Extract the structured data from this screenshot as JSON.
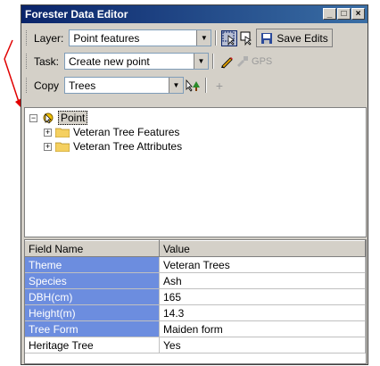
{
  "window": {
    "title": "Forester Data Editor",
    "controls": [
      "minimize",
      "maximize",
      "close"
    ]
  },
  "toolbar1": {
    "layer_label": "Layer:",
    "layer_value": "Point features",
    "save_label": "Save Edits"
  },
  "toolbar2": {
    "task_label": "Task:",
    "task_value": "Create new point",
    "gps_label": "GPS"
  },
  "toolbar3": {
    "copy_label": "Copy",
    "copy_value": "Trees"
  },
  "tree": {
    "root": "Point",
    "children": [
      "Veteran Tree Features",
      "Veteran Tree Attributes"
    ]
  },
  "grid": {
    "headers": [
      "Field Name",
      "Value"
    ],
    "rows": [
      {
        "field": "Theme",
        "value": "Veteran Trees",
        "highlight": true
      },
      {
        "field": "Species",
        "value": "Ash",
        "highlight": true
      },
      {
        "field": "DBH(cm)",
        "value": "165",
        "highlight": true
      },
      {
        "field": "Height(m)",
        "value": "14.3",
        "highlight": true
      },
      {
        "field": "Tree Form",
        "value": "Maiden form",
        "highlight": true
      },
      {
        "field": "Heritage Tree",
        "value": "Yes",
        "highlight": false
      }
    ]
  },
  "colors": {
    "title_bar": "#0a246a",
    "highlight_field": "#6c8ddf",
    "annotation_arrow": "#e00000"
  }
}
